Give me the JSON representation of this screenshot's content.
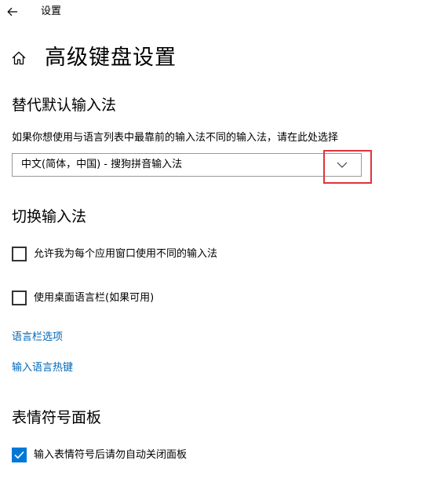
{
  "titlebar": {
    "back_icon": "back-arrow-icon",
    "app_title": "设置"
  },
  "header": {
    "home_icon": "home-icon",
    "title": "高级键盘设置"
  },
  "override_section": {
    "heading": "替代默认输入法",
    "description": "如果你想使用与语言列表中最靠前的输入法不同的输入法，请在此处选择",
    "dropdown_value": "中文(简体，中国) - 搜狗拼音输入法",
    "dropdown_icon": "chevron-down-icon",
    "highlight_color": "#e0343b"
  },
  "switch_section": {
    "heading": "切换输入法",
    "options": [
      {
        "label": "允许我为每个应用窗口使用不同的输入法",
        "checked": false
      },
      {
        "label": "使用桌面语言栏(如果可用)",
        "checked": false
      }
    ],
    "links": [
      {
        "label": "语言栏选项"
      },
      {
        "label": "输入语言热键"
      }
    ]
  },
  "emoji_section": {
    "heading": "表情符号面板",
    "options": [
      {
        "label": "输入表情符号后请勿自动关闭面板",
        "checked": true
      }
    ]
  },
  "colors": {
    "accent": "#0078d7",
    "link": "#0067b8"
  }
}
